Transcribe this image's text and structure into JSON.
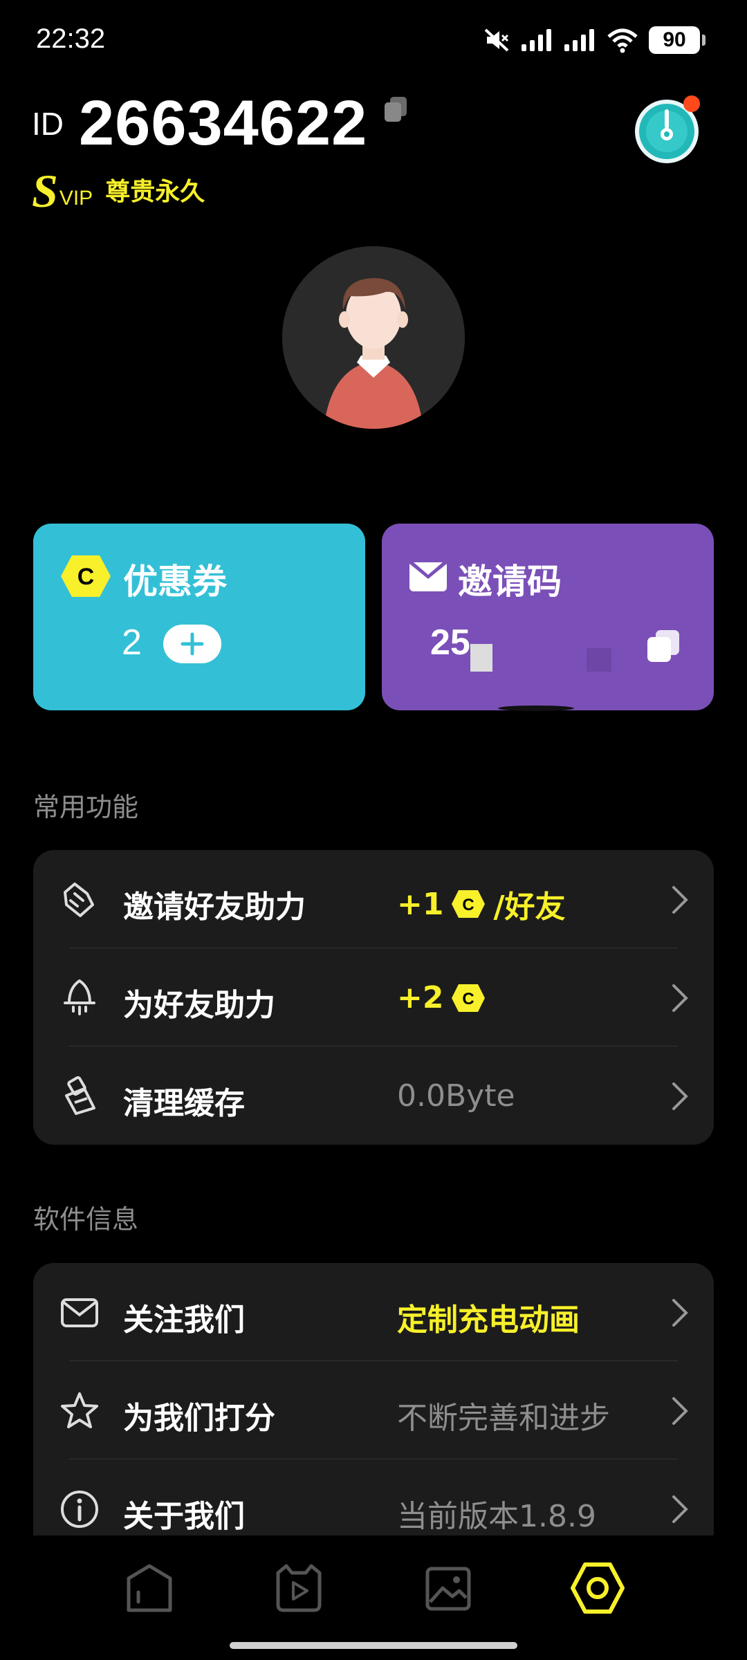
{
  "status_bar": {
    "time": "22:32",
    "battery": "90"
  },
  "header": {
    "id_label": "ID",
    "id_number": "26634622",
    "vip_letter": "S",
    "vip_suffix": "VIP",
    "vip_tier": "尊贵永久"
  },
  "cards": {
    "coupon": {
      "title": "优惠券",
      "count": "2",
      "icon_letter": "C"
    },
    "invite": {
      "title": "邀请码",
      "code": "25"
    }
  },
  "sections": {
    "common": {
      "title": "常用功能",
      "items": [
        {
          "label": "邀请好友助力",
          "value_prefix": "+1",
          "value_suffix": "/好友",
          "icon": "handshake-icon"
        },
        {
          "label": "为好友助力",
          "value_prefix": "+2",
          "value_suffix": "",
          "icon": "rocket-icon"
        },
        {
          "label": "清理缓存",
          "value": "0.0Byte",
          "icon": "broom-icon"
        }
      ]
    },
    "software": {
      "title": "软件信息",
      "items": [
        {
          "label": "关注我们",
          "value": "定制充电动画",
          "icon": "mail-icon"
        },
        {
          "label": "为我们打分",
          "value": "不断完善和进步",
          "icon": "star-icon"
        },
        {
          "label": "关于我们",
          "value": "当前版本1.8.9",
          "icon": "info-icon"
        }
      ]
    }
  },
  "coin_letter": "C",
  "colors": {
    "accent_yellow": "#f7f02a",
    "coupon_card": "#33c0d6",
    "invite_card": "#7b4fb8",
    "panel_bg": "#1c1c1c",
    "notification_dot": "#ff4a1c"
  },
  "bottom_nav": {
    "items": [
      "home-icon",
      "video-icon",
      "gallery-icon",
      "settings-icon"
    ],
    "active": "settings-icon"
  }
}
